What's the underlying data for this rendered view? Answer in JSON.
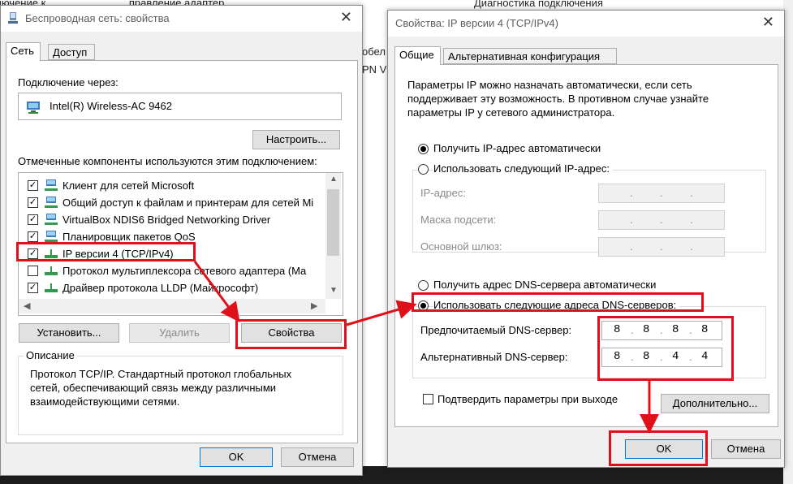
{
  "background": {
    "menu_items": [
      "...дключение к",
      "...правление адаптер...",
      "Диагностика подключения"
    ],
    "side_texts": [
      "обел",
      "PN V"
    ]
  },
  "left_dialog": {
    "title": "Беспроводная сеть: свойства",
    "tabs": [
      "Сеть",
      "Доступ"
    ],
    "connect_via_label": "Подключение через:",
    "adapter_name": "Intel(R) Wireless-AC 9462",
    "configure_button": "Настроить...",
    "components_label": "Отмеченные компоненты используются этим подключением:",
    "components": [
      {
        "label": "Клиент для сетей Microsoft",
        "checked": true
      },
      {
        "label": "Общий доступ к файлам и принтерам для сетей Mi",
        "checked": true
      },
      {
        "label": "VirtualBox NDIS6 Bridged Networking Driver",
        "checked": true
      },
      {
        "label": "Планировщик пакетов QoS",
        "checked": true
      },
      {
        "label": "IP версии 4 (TCP/IPv4)",
        "checked": true
      },
      {
        "label": "Протокол мультиплексора сетевого адаптера (Ma",
        "checked": false
      },
      {
        "label": "Драйвер протокола LLDP (Майкрософт)",
        "checked": true
      }
    ],
    "install_button": "Установить...",
    "remove_button": "Удалить",
    "properties_button": "Свойства",
    "description_label": "Описание",
    "description_text": [
      "Протокол TCP/IP. Стандартный протокол глобальных",
      "сетей, обеспечивающий связь между различными",
      "взаимодействующими сетями."
    ],
    "ok_button": "OK",
    "cancel_button": "Отмена"
  },
  "right_dialog": {
    "title": "Свойства: IP версии 4 (TCP/IPv4)",
    "tabs": [
      "Общие",
      "Альтернативная конфигурация"
    ],
    "intro_text": [
      "Параметры IP можно назначать автоматически, если сеть",
      "поддерживает эту возможность. В противном случае узнайте",
      "параметры IP у сетевого администратора."
    ],
    "ip_auto_radio": "Получить IP-адрес автоматически",
    "ip_manual_radio": "Использовать следующий IP-адрес:",
    "ip_address_label": "IP-адрес:",
    "subnet_label": "Маска подсети:",
    "gateway_label": "Основной шлюз:",
    "dns_auto_radio": "Получить адрес DNS-сервера автоматически",
    "dns_manual_radio": "Использовать следующие адреса DNS-серверов:",
    "preferred_dns_label": "Предпочитаемый DNS-сервер:",
    "preferred_dns": [
      "8",
      "8",
      "8",
      "8"
    ],
    "alternate_dns_label": "Альтернативный DNS-сервер:",
    "alternate_dns": [
      "8",
      "8",
      "4",
      "4"
    ],
    "validate_checkbox": "Подтвердить параметры при выходе",
    "advanced_button": "Дополнительно...",
    "ok_button": "OK",
    "cancel_button": "Отмена"
  },
  "colors": {
    "highlight": "#e0101a",
    "focus_border": "#0078d7"
  }
}
